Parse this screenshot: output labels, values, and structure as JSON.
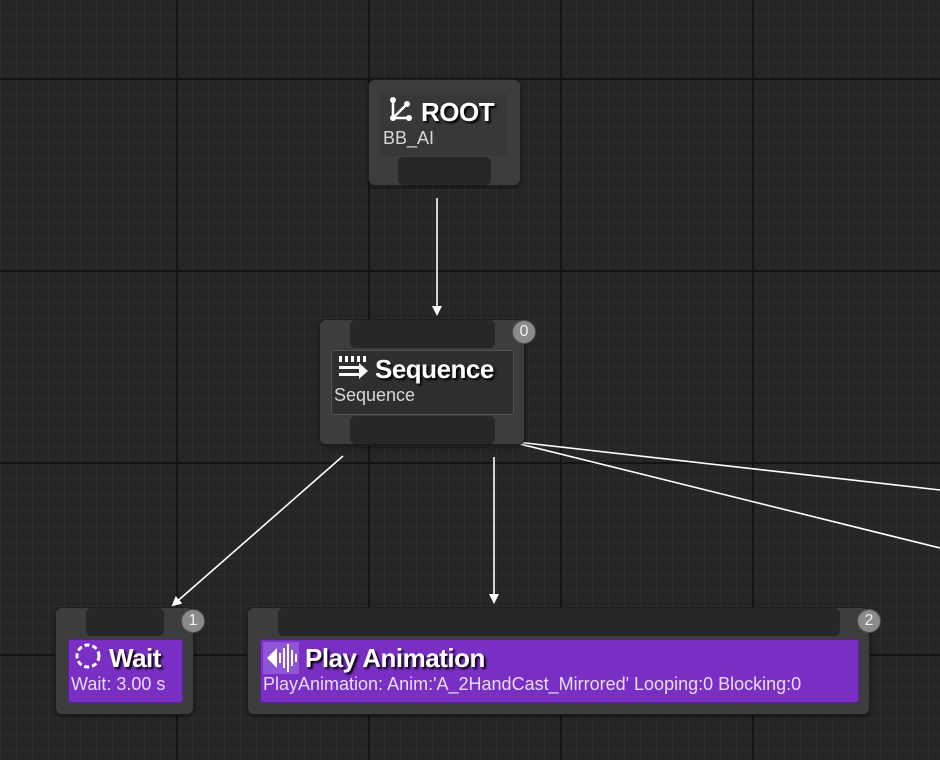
{
  "graph": {
    "root": {
      "title": "ROOT",
      "subtitle": "BB_AI",
      "icon": "root-branch-icon"
    },
    "sequence": {
      "title": "Sequence",
      "subtitle": "Sequence",
      "order": "0",
      "icon": "sequence-arrow-icon"
    },
    "wait": {
      "title": "Wait",
      "subtitle": "Wait: 3.00 s",
      "order": "1",
      "icon": "wait-clock-icon"
    },
    "play_animation": {
      "title": "Play Animation",
      "subtitle": "PlayAnimation: Anim:'A_2HandCast_Mirrored' Looping:0 Blocking:0",
      "order": "2",
      "icon": "animation-waveform-icon"
    }
  },
  "colors": {
    "background": "#262626",
    "task_header": "#7a2fc4",
    "composite_header": "#2f2f2f",
    "wire": "#ffffff"
  }
}
